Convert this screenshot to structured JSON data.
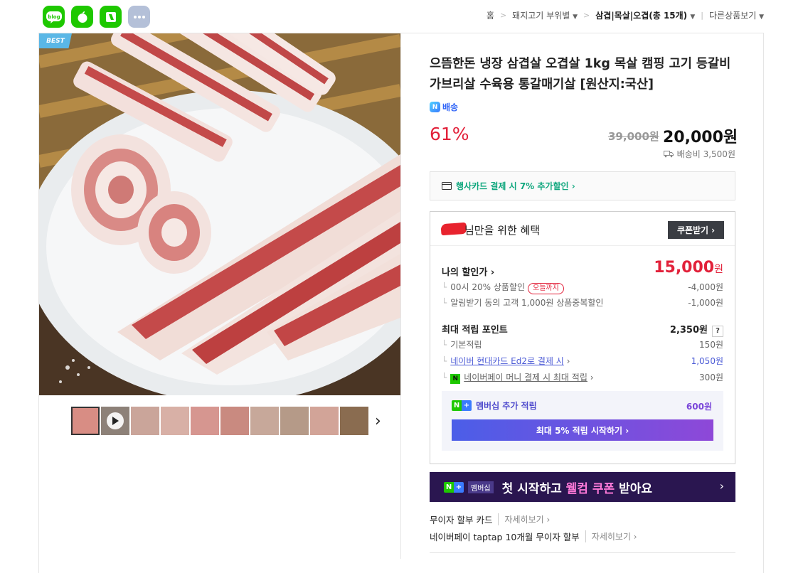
{
  "share": {
    "blog_label": "blog",
    "colors": {
      "blog": "#1ec800",
      "apple": "#1ec800",
      "pin": "#1ec800",
      "more": "#b4c0d8"
    }
  },
  "breadcrumb": {
    "home": "홈",
    "category": "돼지고기 부위별",
    "current": "삼겹|목살|오겹(총 15개)",
    "other": "다른상품보기"
  },
  "product": {
    "best_badge": "BEST",
    "title": "으뜸한돈 냉장 삼겹살 오겹살 1kg 목살 캠핑 고기 등갈비 가브리살 수육용 통갈매기살 [원산지:국산]",
    "delivery_badge": "배송",
    "discount_rate": "61%",
    "original_price": "39,000원",
    "price": "20,000원",
    "shipping": "배송비 3,500원",
    "card_promo": "행사카드 결제 시 7% 추가할인 ›"
  },
  "benefit": {
    "title": "님만을 위한 혜택",
    "coupon_button": "쿠폰받기",
    "my_price_label": "나의 할인가",
    "my_price_value": "15,000",
    "my_price_unit": "원",
    "discounts": [
      {
        "label": "00시 20% 상품할인",
        "pill": "오늘까지",
        "value": "-4,000원"
      },
      {
        "label": "알림받기 동의 고객 1,000원 상품중복할인",
        "value": "-1,000원"
      }
    ],
    "points_label": "최대 적립 포인트",
    "points_value": "2,350원",
    "points_help": "?",
    "points": [
      {
        "label": "기본적립",
        "value": "150원"
      },
      {
        "label": "네이버 현대카드 Ed2로 결제 시",
        "value": "1,050원"
      },
      {
        "label": "네이버페이 머니 결제 시 최대 적립",
        "value": "300원"
      }
    ],
    "membership_label": "멤버십 추가 적립",
    "membership_value": "600원",
    "membership_button": "최대 5% 적립 시작하기 ›"
  },
  "banner": {
    "badge": "멤버십",
    "text_before": "첫 시작하고 ",
    "text_em": "웰컴 쿠폰",
    "text_after": " 받아요"
  },
  "installment": [
    {
      "label": "무이자 할부 카드",
      "more": "자세히보기 ›"
    },
    {
      "label": "네이버페이 taptap 10개월 무이자 할부",
      "more": "자세히보기 ›"
    }
  ]
}
